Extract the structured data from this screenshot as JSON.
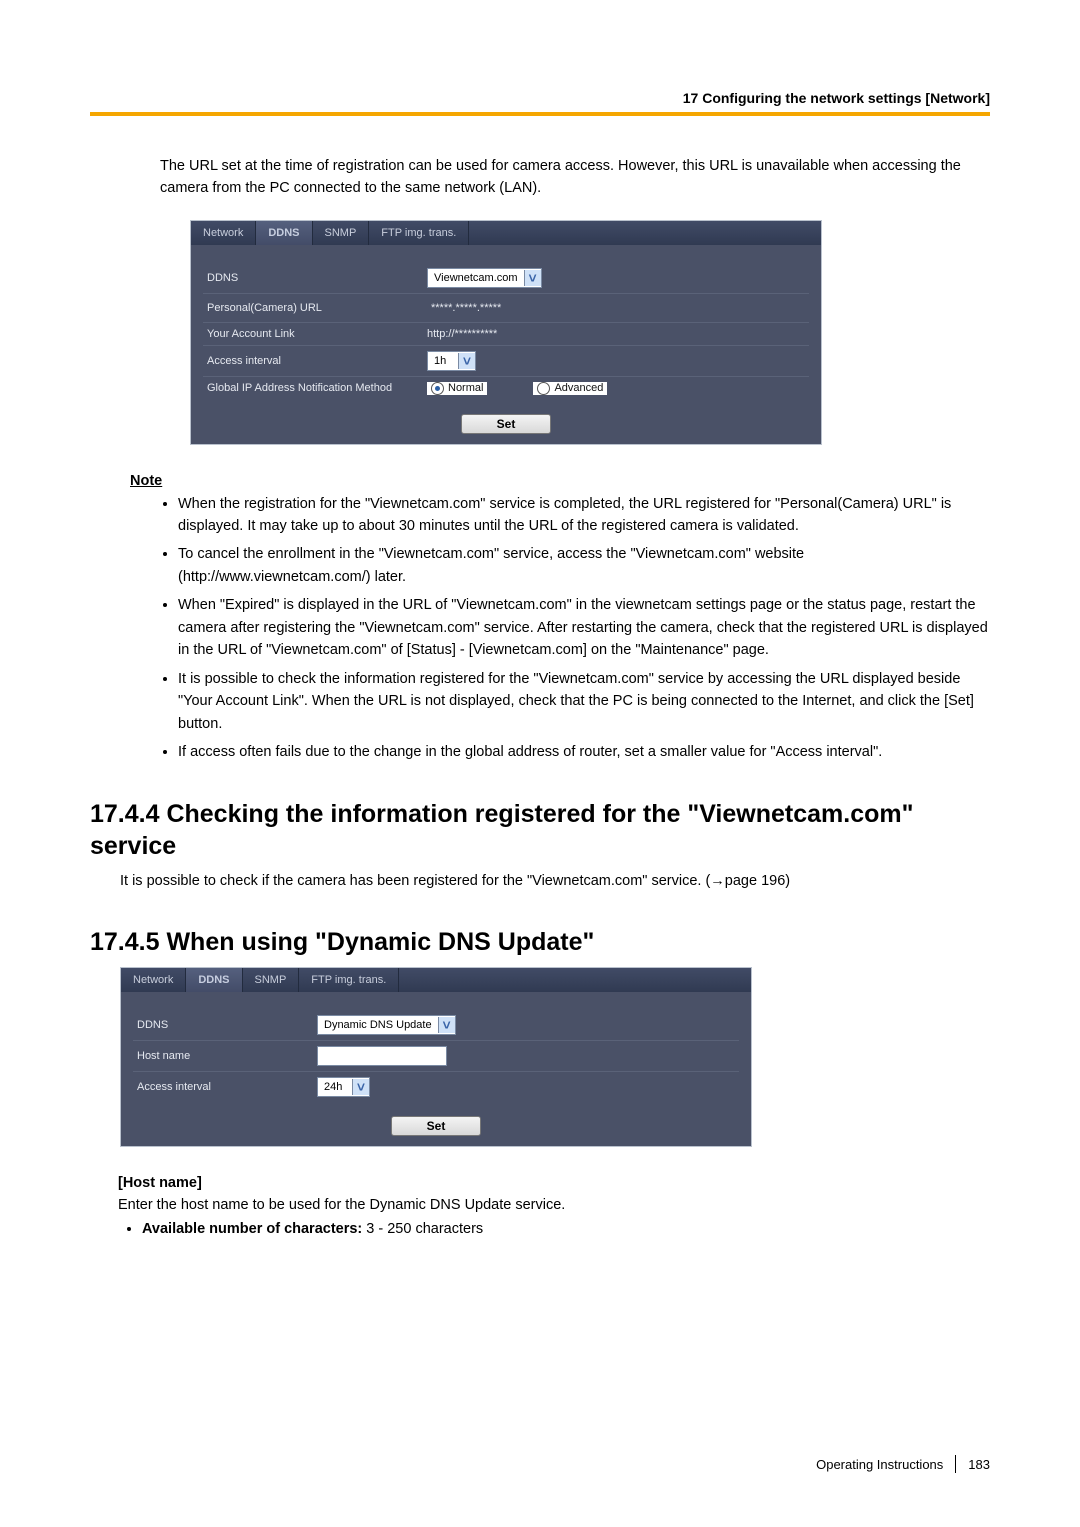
{
  "header": {
    "title": "17 Configuring the network settings [Network]"
  },
  "intro": "The URL set at the time of registration can be used for camera access. However, this URL is unavailable when accessing the camera from the PC connected to the same network (LAN).",
  "screenshot1": {
    "tabs": [
      "Network",
      "DDNS",
      "SNMP",
      "FTP img. trans."
    ],
    "active_tab_index": 1,
    "rows": {
      "ddns_label": "DDNS",
      "ddns_value": "Viewnetcam.com",
      "personal_url_label": "Personal(Camera) URL",
      "personal_url_value": "*****.*****.*****",
      "account_label": "Your Account Link",
      "account_value": "http://**********",
      "interval_label": "Access interval",
      "interval_value": "1h",
      "notif_label": "Global IP Address Notification Method",
      "notif_opt1": "Normal",
      "notif_opt2": "Advanced"
    },
    "set_btn": "Set"
  },
  "note_heading": "Note",
  "notes": [
    "When the registration for the \"Viewnetcam.com\" service is completed, the URL registered for \"Personal(Camera) URL\" is displayed. It may take up to about 30 minutes until the URL of the registered camera is validated.",
    "To cancel the enrollment in the \"Viewnetcam.com\" service, access the \"Viewnetcam.com\" website (http://www.viewnetcam.com/) later.",
    "When \"Expired\" is displayed in the URL of \"Viewnetcam.com\" in the viewnetcam settings page or the status page, restart the camera after registering the \"Viewnetcam.com\" service. After restarting the camera, check that the registered URL is displayed in the URL of \"Viewnetcam.com\" of [Status] - [Viewnetcam.com] on the \"Maintenance\" page.",
    "It is possible to check the information registered for the \"Viewnetcam.com\" service by accessing the URL displayed beside \"Your Account Link\". When the URL is not displayed, check that the PC is being connected to the Internet, and click the [Set] button.",
    "If access often fails due to the change in the global address of router, set a smaller value for \"Access interval\"."
  ],
  "h_1744": "17.4.4  Checking the information registered for the \"Viewnetcam.com\" service",
  "p_1744": "It is possible to check if the camera has been registered for the \"Viewnetcam.com\" service. (→page 196)",
  "h_1745": "17.4.5  When using \"Dynamic DNS Update\"",
  "screenshot2": {
    "tabs": [
      "Network",
      "DDNS",
      "SNMP",
      "FTP img. trans."
    ],
    "active_tab_index": 1,
    "rows": {
      "ddns_label": "DDNS",
      "ddns_value": "Dynamic DNS Update",
      "host_label": "Host name",
      "host_value": "",
      "interval_label": "Access interval",
      "interval_value": "24h"
    },
    "set_btn": "Set"
  },
  "hostname_head": "[Host name]",
  "hostname_desc": "Enter the host name to be used for the Dynamic DNS Update service.",
  "hostname_chars_label": "Available number of characters:",
  "hostname_chars_value": " 3 - 250 characters",
  "footer": {
    "doc": "Operating Instructions",
    "page": "183"
  }
}
